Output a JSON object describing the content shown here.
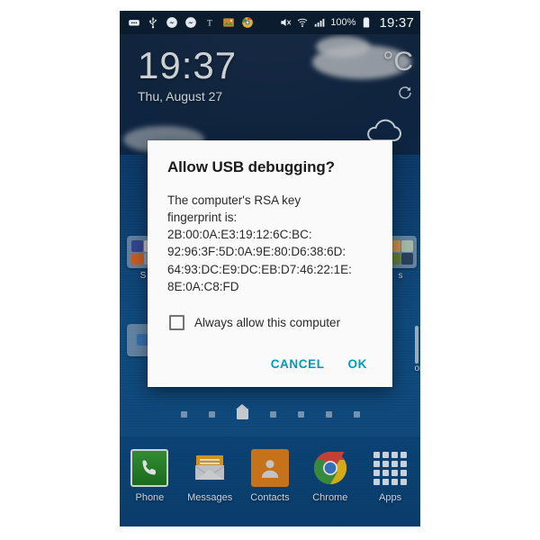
{
  "statusbar": {
    "icons": [
      {
        "name": "message-icon"
      },
      {
        "name": "usb-icon"
      },
      {
        "name": "messenger-icon"
      },
      {
        "name": "messenger-icon-2"
      },
      {
        "name": "nytimes-icon"
      },
      {
        "name": "photo-app-icon"
      },
      {
        "name": "browser-icon"
      }
    ],
    "mute_icon": "mute-icon",
    "wifi_icon": "wifi-icon",
    "signal_icon": "signal-bars-icon",
    "battery_percent": "100%",
    "battery_icon": "battery-full-icon",
    "clock": "19:37"
  },
  "lockscreen": {
    "time": "19:37",
    "date": "Thu, August 27",
    "weather_unit": "C",
    "weather_degree_symbol": "°",
    "refresh_icon": "refresh-icon",
    "cloud_icon": "cloud-outline-icon"
  },
  "homescreen": {
    "left_label": "S",
    "right_label": "s",
    "more_label": "ore",
    "page_indicator": {
      "count": 7,
      "home_index": 2
    }
  },
  "dock": {
    "items": [
      {
        "label": "Phone",
        "icon": "phone-icon"
      },
      {
        "label": "Messages",
        "icon": "messages-icon"
      },
      {
        "label": "Contacts",
        "icon": "contacts-icon"
      },
      {
        "label": "Chrome",
        "icon": "chrome-icon"
      },
      {
        "label": "Apps",
        "icon": "apps-grid-icon"
      }
    ]
  },
  "dialog": {
    "title": "Allow USB debugging?",
    "message": "The computer's RSA key\nfingerprint is:",
    "fingerprint": "2B:00:0A:E3:19:12:6C:BC:\n92:96:3F:5D:0A:9E:80:D6:38:6D:\n64:93:DC:E9:DC:EB:D7:46:22:1E:\n8E:0A:C8:FD",
    "checkbox_label": "Always allow this computer",
    "checkbox_checked": false,
    "cancel_label": "CANCEL",
    "ok_label": "OK",
    "accent_color": "#009bb5"
  }
}
